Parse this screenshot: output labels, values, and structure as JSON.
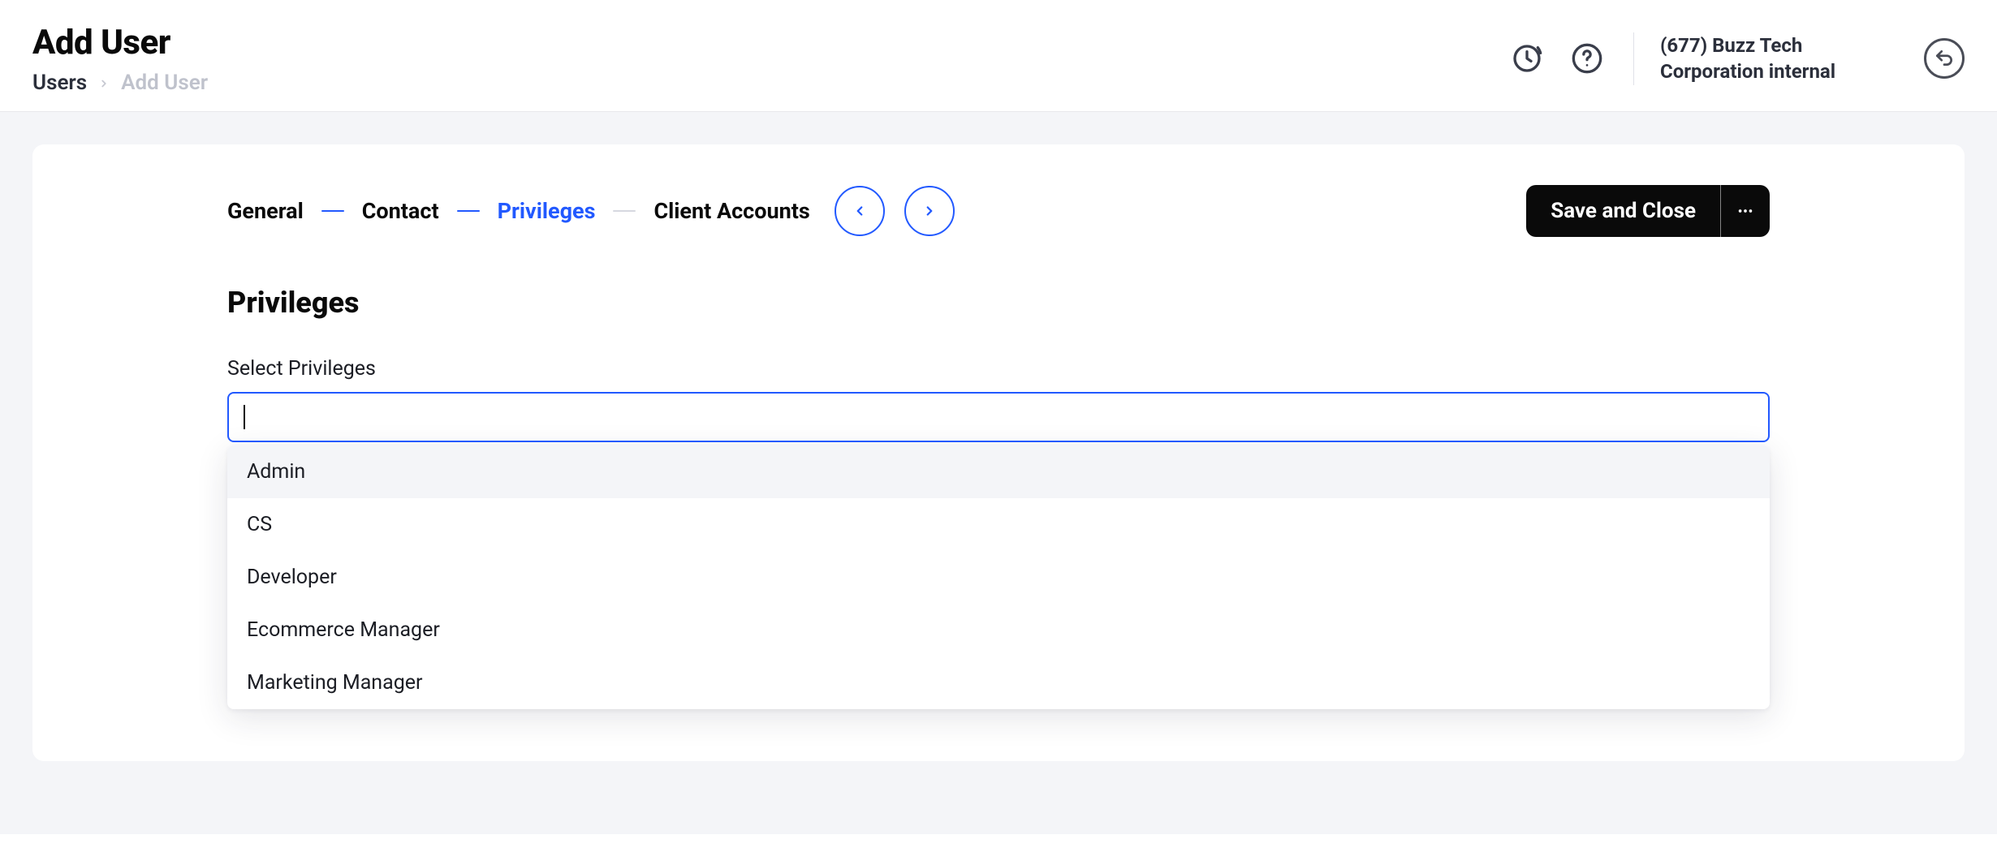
{
  "header": {
    "title": "Add User",
    "breadcrumb_root": "Users",
    "breadcrumb_current": "Add User",
    "org_label": "(677) Buzz Tech Corporation internal"
  },
  "steps": {
    "items": [
      "General",
      "Contact",
      "Privileges",
      "Client Accounts"
    ],
    "active_index": 2,
    "save_label": "Save and Close"
  },
  "privileges": {
    "section_title": "Privileges",
    "field_label": "Select Privileges",
    "input_value": "",
    "options": [
      "Admin",
      "CS",
      "Developer",
      "Ecommerce Manager",
      "Marketing Manager"
    ],
    "highlighted_index": 0
  }
}
